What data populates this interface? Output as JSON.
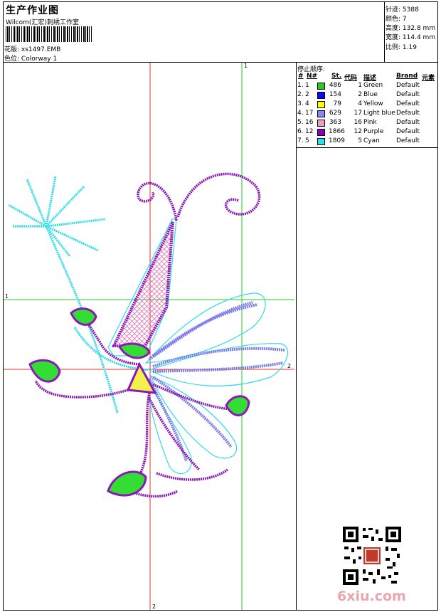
{
  "header": {
    "title": "生产作业图",
    "company": "Wilcom(汇宏)刺绣工作室",
    "design_label": "花版:",
    "design_value": "xs1497.EMB",
    "colorway_label": "色位:",
    "colorway_value": "Colorway 1"
  },
  "stats": {
    "stitches": {
      "label": "针迹:",
      "value": "5388"
    },
    "colors": {
      "label": "颜色:",
      "value": "7"
    },
    "height": {
      "label": "高度:",
      "value": "132.8 mm"
    },
    "width": {
      "label": "宽度:",
      "value": "114.4 mm"
    },
    "scale": {
      "label": "比例:",
      "value": "1.19"
    }
  },
  "stop_sequence": {
    "title": "停止顺序:",
    "headers": {
      "num": "#",
      "n": "N#",
      "st": "St.",
      "code": "代码",
      "desc": "描述",
      "brand": "Brand",
      "elem": "元素"
    },
    "rows": [
      {
        "num": "1.",
        "n": "1",
        "st": "486",
        "code": "1",
        "desc": "Green",
        "brand": "Default",
        "color": "#19d219"
      },
      {
        "num": "2.",
        "n": "2",
        "st": "154",
        "code": "2",
        "desc": "Blue",
        "brand": "Default",
        "color": "#0a0af0"
      },
      {
        "num": "3.",
        "n": "4",
        "st": "79",
        "code": "4",
        "desc": "Yellow",
        "brand": "Default",
        "color": "#ffff00"
      },
      {
        "num": "4.",
        "n": "17",
        "st": "629",
        "code": "17",
        "desc": "Light blue",
        "brand": "Default",
        "color": "#8888ee"
      },
      {
        "num": "5.",
        "n": "16",
        "st": "363",
        "code": "16",
        "desc": "Pink",
        "brand": "Default",
        "color": "#f39ac0"
      },
      {
        "num": "6.",
        "n": "12",
        "st": "1866",
        "code": "12",
        "desc": "Purple",
        "brand": "Default",
        "color": "#8a00b8"
      },
      {
        "num": "7.",
        "n": "5",
        "st": "1809",
        "code": "5",
        "desc": "Cyan",
        "brand": "Default",
        "color": "#22e2f0"
      }
    ]
  },
  "guides": {
    "top_label": "1",
    "left_label": "1",
    "right_label": "2",
    "bottom_label": "2"
  },
  "colors": {
    "red_guide": "#e03030",
    "green_guide": "#22cc22",
    "purple": "#8a18b8",
    "cyan": "#2cdde8",
    "light_blue": "#7a7aea",
    "green": "#33dd33",
    "pink": "#e080b8",
    "yellow": "#f2f24a"
  },
  "watermark": {
    "text": "6xiu.com",
    "icon": "qr-code-icon"
  }
}
